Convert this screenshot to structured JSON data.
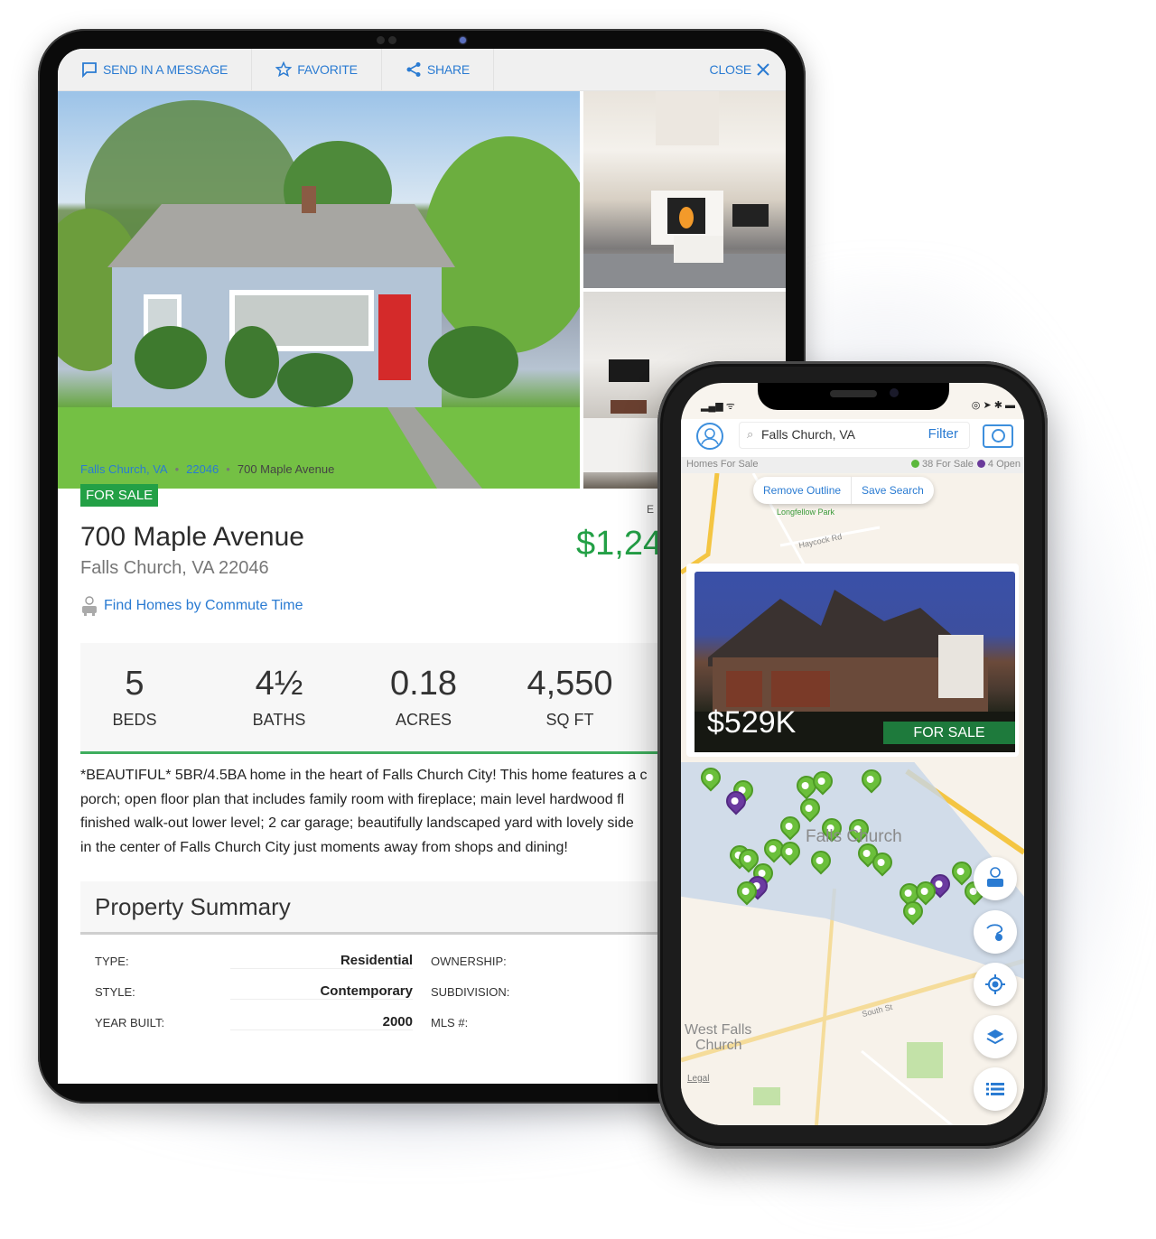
{
  "tablet": {
    "toolbar": {
      "message": "SEND IN A MESSAGE",
      "favorite": "FAVORITE",
      "share": "SHARE",
      "close": "CLOSE"
    },
    "breadcrumb": {
      "city": "Falls Church, VA",
      "zip": "22046",
      "address": "700 Maple Avenue"
    },
    "status_badge": "FOR SALE",
    "address": "700 Maple Avenue",
    "city_line": "Falls Church, VA 22046",
    "price_visible": "$1,24",
    "price_label_partial": "E",
    "commute_link": "Find Homes by Commute Time",
    "stats": [
      {
        "value": "5",
        "label": "BEDS"
      },
      {
        "value": "4½",
        "label": "BATHS"
      },
      {
        "value": "0.18",
        "label": "ACRES"
      },
      {
        "value": "4,550",
        "label": "SQ FT"
      }
    ],
    "description": [
      "*BEAUTIFUL* 5BR/4.5BA home in the heart of Falls Church City! This home features a c",
      "porch; open floor plan that includes family room with fireplace; main level hardwood fl",
      "finished walk-out lower level; 2 car garage; beautifully landscaped yard with lovely side",
      "in the center of Falls Church City just moments away from shops and dining!"
    ],
    "summary": {
      "title": "Property Summary",
      "rows": [
        {
          "key": "TYPE:",
          "value": "Residential",
          "key2": "OWNERSHIP:"
        },
        {
          "key": "STYLE:",
          "value": "Contemporary",
          "key2": "SUBDIVISION:"
        },
        {
          "key": "YEAR BUILT:",
          "value": "2000",
          "key2": "MLS #:"
        }
      ]
    },
    "colors": {
      "accent": "#2a7bd2",
      "sale_green": "#23a046"
    }
  },
  "phone": {
    "status_left": "▂▄▆ ᯤ",
    "status_right": "◎ ➤ ✱ ▬",
    "search": {
      "value": "Falls Church, VA",
      "filter_label": "Filter"
    },
    "infobar": {
      "label": "Homes For Sale",
      "for_sale": "38 For Sale",
      "open": "4 Open"
    },
    "map_buttons": {
      "remove_outline": "Remove Outline",
      "save_search": "Save Search"
    },
    "listing_card": {
      "price": "$529K",
      "status": "FOR SALE"
    },
    "map_labels": {
      "area": "Falls Church",
      "area2_line1": "West Falls",
      "area2_line2": "Church",
      "park": "Longfellow Park",
      "street1": "Haycock Rd",
      "street2": "South St",
      "legal": "Legal"
    },
    "fabs": [
      "commute-icon",
      "draw-icon",
      "locate-icon",
      "layers-icon",
      "list-icon"
    ]
  }
}
